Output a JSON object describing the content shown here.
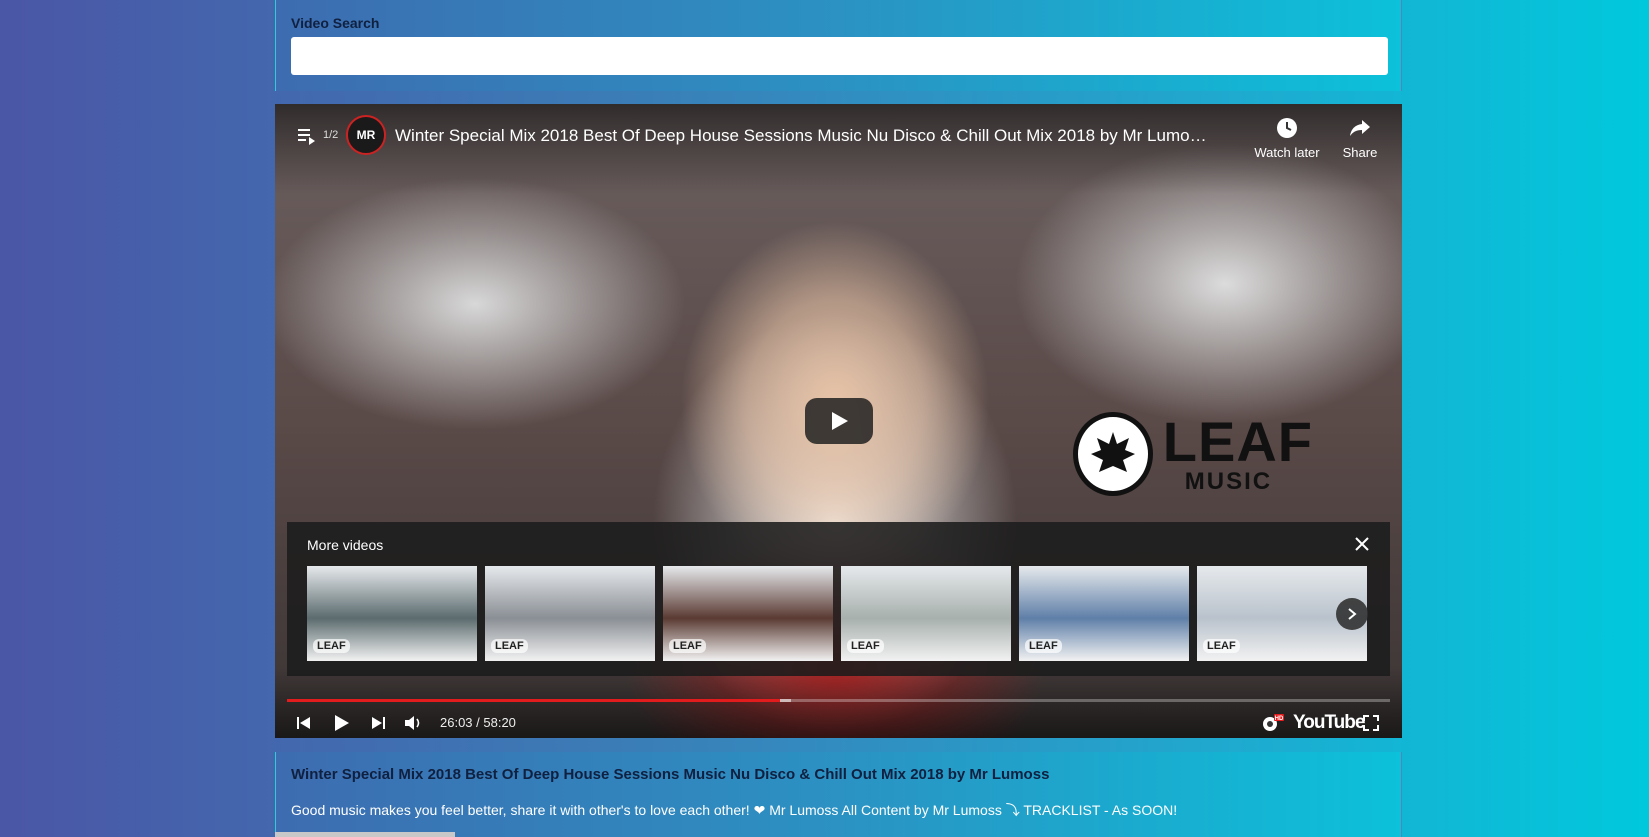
{
  "search": {
    "label": "Video Search",
    "value": "",
    "placeholder": ""
  },
  "player": {
    "playlist_count": "1/2",
    "channel_badge": "MR",
    "title": "Winter Special Mix 2018 Best Of Deep House Sessions Music Nu Disco & Chill Out Mix 2018 by Mr Lumo…",
    "watch_later_label": "Watch later",
    "share_label": "Share",
    "overlay_logo": {
      "line1": "LEAF",
      "line2": "MUSIC"
    },
    "more_videos": {
      "title": "More videos",
      "thumbnails": [
        {
          "mark": "LEAF",
          "tone": "#5b6b6e"
        },
        {
          "mark": "LEAF",
          "tone": "#8a8f95"
        },
        {
          "mark": "LEAF",
          "tone": "#5a3a32"
        },
        {
          "mark": "LEAF",
          "tone": "#a7b0ad"
        },
        {
          "mark": "LEAF",
          "tone": "#5f7fa8"
        },
        {
          "mark": "LEAF",
          "tone": "#b9c2cc"
        }
      ]
    },
    "time_display": "26:03 / 58:20",
    "progress_played": 0.447,
    "progress_buffered": 0.457,
    "hd_badge": "HD",
    "youtube_label": "YouTube",
    "colors": {
      "progress": "#e21c1c",
      "hd_badge": "#e21c1c"
    }
  },
  "info": {
    "title": "Winter Special Mix 2018 Best Of Deep House Sessions Music Nu Disco & Chill Out Mix 2018 by Mr Lumoss",
    "description": "Good music makes you feel better, share it with other's to love each other! ❤ Mr Lumoss All Content by Mr Lumoss ⤵ TRACKLIST - As SOON!"
  }
}
